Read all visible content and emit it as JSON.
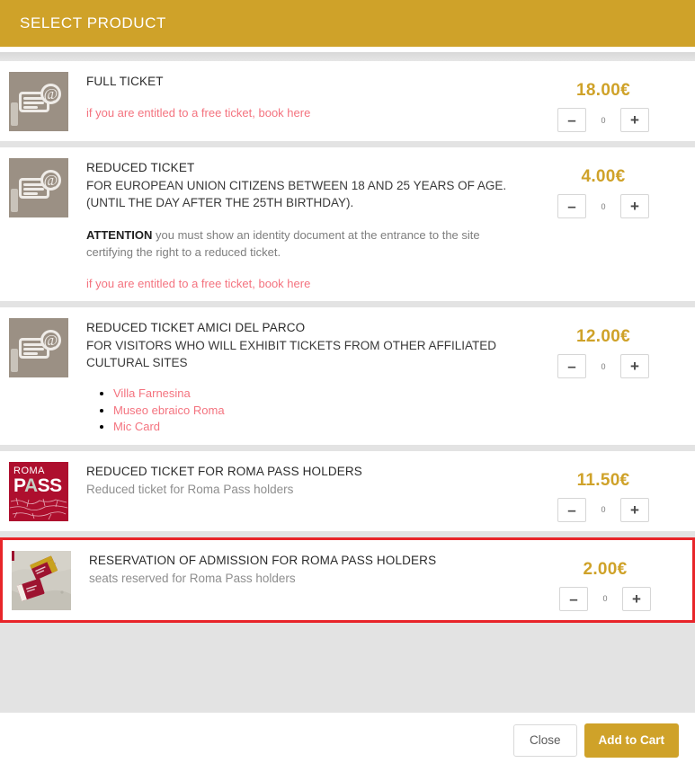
{
  "header": {
    "title": "SELECT PRODUCT",
    "accent_color": "#cfa229"
  },
  "colors": {
    "accent": "#cfa229",
    "link": "#f4737f",
    "highlight_border": "#e8252a",
    "thumb_taupe": "#9b9084",
    "romapass_red": "#ae0f2e"
  },
  "products": [
    {
      "icon": "ticket-at-icon",
      "title": "FULL TICKET",
      "subtitle": "",
      "note_bold": "",
      "note": "",
      "link": "if you are entitled to a free ticket, book here",
      "list": [],
      "price": "18.00€",
      "quantity": "0",
      "minus": "–",
      "plus": "+",
      "highlighted": false
    },
    {
      "icon": "ticket-at-icon",
      "title": "REDUCED TICKET",
      "subtitle": "FOR EUROPEAN UNION CITIZENS BETWEEN 18 AND 25 YEARS OF AGE. (UNTIL THE DAY AFTER THE 25TH BIRTHDAY).",
      "note_bold": "ATTENTION",
      "note": " you must show an identity document at the entrance to the site certifying the right to a reduced ticket.",
      "link": "if you are entitled to a free ticket, book here",
      "list": [],
      "price": "4.00€",
      "quantity": "0",
      "minus": "–",
      "plus": "+",
      "highlighted": false
    },
    {
      "icon": "ticket-at-icon",
      "title": "REDUCED TICKET AMICI DEL PARCO",
      "subtitle": "FOR VISITORS WHO WILL EXHIBIT TICKETS FROM OTHER AFFILIATED CULTURAL SITES",
      "note_bold": "",
      "note": "",
      "link": "",
      "list": [
        "Villa Farnesina",
        "Museo ebraico Roma",
        "Mic Card"
      ],
      "price": "12.00€",
      "quantity": "0",
      "minus": "–",
      "plus": "+",
      "highlighted": false
    },
    {
      "icon": "romapass-logo",
      "title": "REDUCED TICKET FOR ROMA PASS HOLDERS",
      "subtitle": "Reduced ticket for Roma Pass holders",
      "note_bold": "",
      "note": "",
      "link": "",
      "list": [],
      "price": "11.50€",
      "quantity": "0",
      "minus": "–",
      "plus": "+",
      "highlighted": false
    },
    {
      "icon": "romapass-photo",
      "title": "RESERVATION OF ADMISSION FOR ROMA PASS HOLDERS",
      "subtitle": "seats reserved for Roma Pass holders",
      "note_bold": "",
      "note": "",
      "link": "",
      "list": [],
      "price": "2.00€",
      "quantity": "0",
      "minus": "–",
      "plus": "+",
      "highlighted": true
    }
  ],
  "romapass_logo": {
    "line1": "ROMA",
    "p": "P",
    "a": "A",
    "ss": "SS"
  },
  "footer": {
    "close_label": "Close",
    "add_to_cart_label": "Add to Cart"
  }
}
